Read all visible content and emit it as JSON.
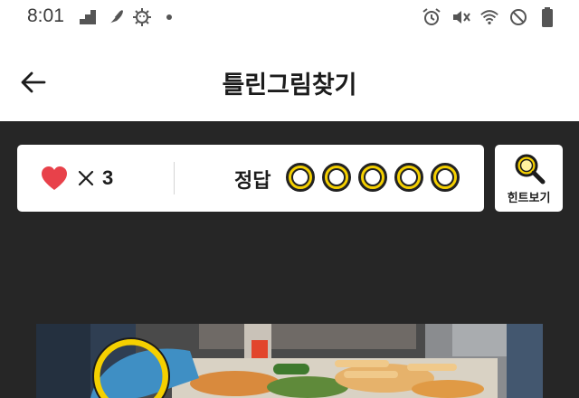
{
  "status_bar": {
    "time": "8:01",
    "left_icons": [
      "stairs-icon",
      "feather-icon",
      "sun-face-icon",
      "dot-icon"
    ],
    "right_icons": [
      "alarm-icon",
      "mute-icon",
      "wifi-icon",
      "no-entry-icon",
      "battery-icon"
    ]
  },
  "header": {
    "title": "틀린그림찾기",
    "back_icon": "arrow-left-icon"
  },
  "score": {
    "lives_icon": "heart-icon",
    "multiplier": "×",
    "lives": "3",
    "answer_label": "정답",
    "answers_total": 5,
    "answers_found": 0
  },
  "hint": {
    "label": "힌트보기",
    "icon": "magnifier-icon"
  },
  "colors": {
    "dark_bg": "#262626",
    "accent_yellow": "#f5d000",
    "heart_red": "#e8414a"
  }
}
